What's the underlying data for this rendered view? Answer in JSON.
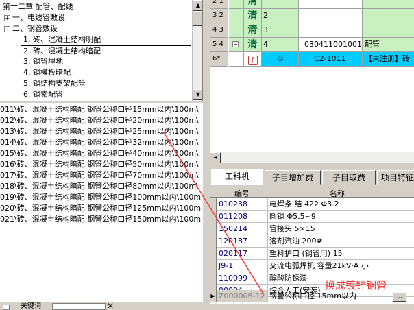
{
  "tree": {
    "items": [
      {
        "text": "第十二章  配管、配线",
        "pm": ""
      },
      {
        "text": "一、电线管敷设",
        "pm": "+"
      },
      {
        "text": "二、钢管敷设",
        "pm": "-"
      },
      {
        "text": "1.  砖、混凝土结构明配",
        "pm": ""
      },
      {
        "text": "2.  砖、混凝土结构暗配",
        "pm": ""
      },
      {
        "text": "3.  钢管埋地",
        "pm": ""
      },
      {
        "text": "4.  钢模板暗配",
        "pm": ""
      },
      {
        "text": "5.  钢结构支架配管",
        "pm": ""
      },
      {
        "text": "6.  钢索配管",
        "pm": ""
      }
    ]
  },
  "list": {
    "rows": [
      "011\\砖、混凝土结构暗配 钢管公称口径15mm以内\\100m\\",
      "012\\砖、混凝土结构暗配 钢管公称口径20mm以内\\100m\\",
      "013\\砖、混凝土结构暗配 钢管公称口径25mm以内\\100m\\",
      "014\\砖、混凝土结构暗配 钢管公称口径32mm以内\\100m\\",
      "015\\砖、混凝土结构暗配 钢管公称口径40mm以内\\100m\\",
      "016\\砖、混凝土结构暗配 钢管公称口径50mm以内\\100m\\",
      "017\\砖、混凝土结构暗配 钢管公称口径70mm以内\\100m\\",
      "018\\砖、混凝土结构暗配 钢管公称口径80mm以内\\100m\\",
      "019\\砖、混凝土结构暗配 钢管公称口径100mm以内\\100m",
      "020\\砖、混凝土结构暗配 钢管公称口径125mm以内\\100m",
      "021\\砖、混凝土结构暗配 钢管公称口径150mm以内\\100m"
    ]
  },
  "bottom_left": {
    "keyword_label": "关键词"
  },
  "grid_top": {
    "rows": [
      {
        "num": "2 1",
        "qing": "清",
        "c3": "",
        "c4": "",
        "c5": ""
      },
      {
        "num": "3 2",
        "qing": "清",
        "c3": "2",
        "c4": "",
        "c5": ""
      },
      {
        "num": "4 3",
        "qing": "清",
        "c3": "3",
        "c4": "",
        "c5": ""
      },
      {
        "num": "5 4",
        "qing": "清",
        "c3": "4",
        "c4": "030411001001",
        "c5": "配管"
      },
      {
        "num": "6*",
        "qing": "",
        "c3": "①",
        "c4": "C2-1011",
        "c5": "【未注册】砖"
      }
    ]
  },
  "tabs": [
    "工料机",
    "子目增加费",
    "子目取费",
    "项目特征"
  ],
  "resources": {
    "col_code": "编号",
    "col_name": "名称",
    "rows": [
      {
        "code": "010238",
        "name": "电焊条 结 422 Φ3.2"
      },
      {
        "code": "011208",
        "name": "圆钢 Φ5.5~9"
      },
      {
        "code": "150214",
        "name": "管接头 5×15"
      },
      {
        "code": "120187",
        "name": "溶剂汽油 200#"
      },
      {
        "code": "020117",
        "name": "塑料护口 (钢管用) 15"
      },
      {
        "code": "J9-1",
        "name": "交流电弧焊机 容量21kV·A 小"
      },
      {
        "code": "110099",
        "name": "醇酸防锈漆"
      },
      {
        "code": "00004",
        "name": "综合人工(安装)"
      },
      {
        "code": "Z000006-12",
        "name": "钢管公称口径 15mm以内"
      }
    ]
  },
  "annotation": "换成镀锌钢管",
  "ellipsis_label": "..."
}
